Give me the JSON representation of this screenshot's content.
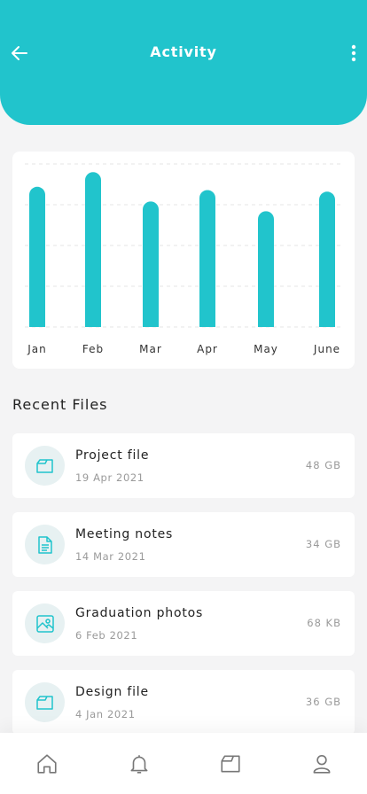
{
  "header": {
    "title": "Activity",
    "back_icon": "arrow-left-icon",
    "menu_icon": "more-vertical-icon",
    "color": "#21c4cc"
  },
  "chart_data": {
    "type": "bar",
    "categories": [
      "Jan",
      "Feb",
      "Mar",
      "Apr",
      "May",
      "June"
    ],
    "values": [
      0.86,
      0.95,
      0.77,
      0.84,
      0.71,
      0.83
    ],
    "ylim": [
      0,
      1
    ],
    "grid": true,
    "bar_color": "#21c4cc",
    "title": "",
    "xlabel": "",
    "ylabel": ""
  },
  "recent": {
    "title": "Recent Files",
    "files": [
      {
        "name": "Project file",
        "date": "19 Apr 2021",
        "size": "48 GB",
        "icon": "folder-icon"
      },
      {
        "name": "Meeting notes",
        "date": "14 Mar 2021",
        "size": "34 GB",
        "icon": "document-icon"
      },
      {
        "name": "Graduation photos",
        "date": "6 Feb 2021",
        "size": "68 KB",
        "icon": "image-icon"
      },
      {
        "name": "Design file",
        "date": "4 Jan 2021",
        "size": "36 GB",
        "icon": "folder-icon"
      }
    ]
  },
  "nav": {
    "items": [
      "home-icon",
      "bell-icon",
      "folder-icon",
      "profile-icon"
    ]
  }
}
